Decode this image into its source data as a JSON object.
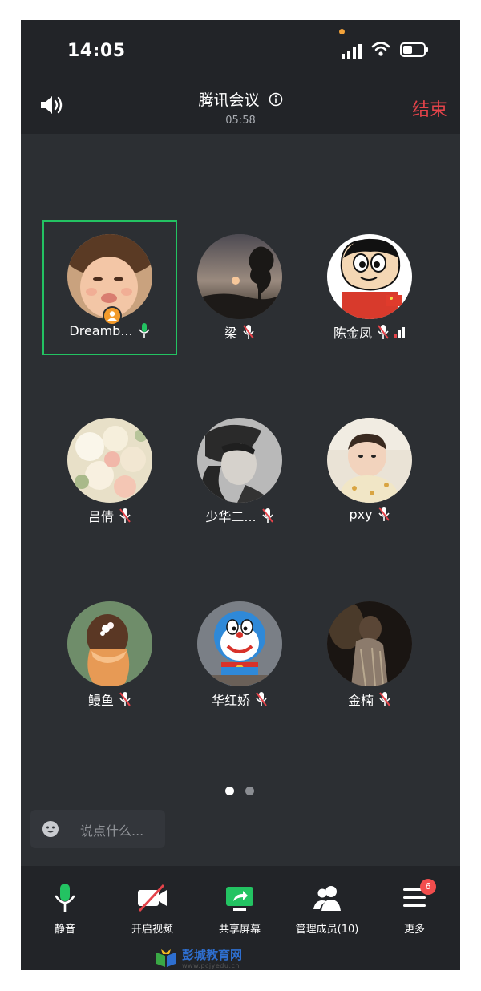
{
  "status_bar": {
    "time": "14:05"
  },
  "header": {
    "title": "腾讯会议",
    "duration": "05:58",
    "end_label": "结束"
  },
  "participants": [
    {
      "name": "Dreamb...",
      "mic": "on",
      "host": true,
      "active": true
    },
    {
      "name": "梁",
      "mic": "muted"
    },
    {
      "name": "陈金凤",
      "mic": "muted",
      "network": true
    },
    {
      "name": "吕倩",
      "mic": "muted"
    },
    {
      "name": "少华二...",
      "mic": "muted"
    },
    {
      "name": "pxy",
      "mic": "muted"
    },
    {
      "name": "鳗鱼",
      "mic": "muted"
    },
    {
      "name": "华红娇",
      "mic": "muted"
    },
    {
      "name": "金楠",
      "mic": "muted"
    }
  ],
  "chat": {
    "placeholder": "说点什么..."
  },
  "toolbar": {
    "mute_label": "静音",
    "video_label": "开启视频",
    "share_label": "共享屏幕",
    "members_label": "管理成员(10)",
    "more_label": "更多",
    "more_badge": "6"
  },
  "watermark": {
    "name": "彭城教育网",
    "url": "www.pcjyedu.cn"
  },
  "colors": {
    "accent_green": "#23c362",
    "end_red": "#e5434a",
    "badge_red": "#f24d4d",
    "host_orange": "#f39a2b"
  }
}
